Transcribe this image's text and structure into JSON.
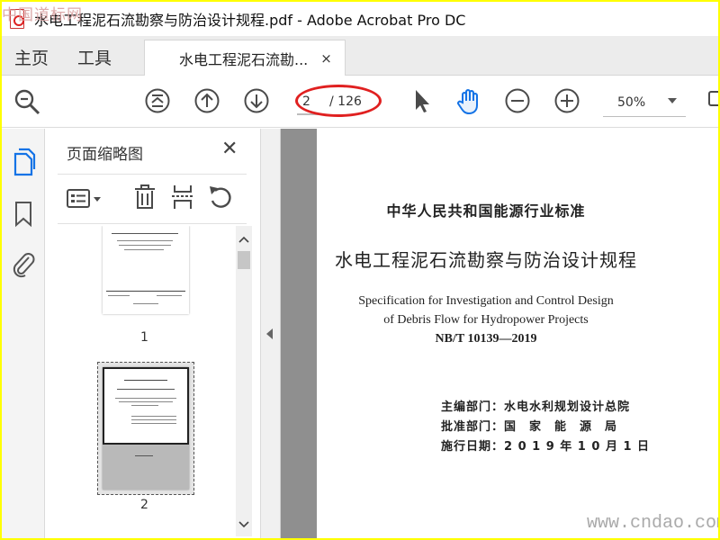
{
  "window": {
    "title": "水电工程泥石流勘察与防治设计规程.pdf - Adobe Acrobat Pro DC",
    "watermark_top": "中国道标网"
  },
  "tabs": {
    "home": "主页",
    "tools": "工具",
    "document": "水电工程泥石流勘...",
    "close": "×"
  },
  "toolbar": {
    "current_page": "2",
    "total_pages": "/ 126",
    "zoom": "50%"
  },
  "panel": {
    "title": "页面缩略图",
    "close": "✕",
    "thumbnails": [
      {
        "label": "1"
      },
      {
        "label": "2"
      }
    ]
  },
  "document": {
    "line1": "中华人民共和国能源行业标准",
    "line2": "水电工程泥石流勘察与防治设计规程",
    "en1": "Specification for Investigation and Control Design",
    "en2": "of Debris Flow for Hydropower Projects",
    "code": "NB/T 10139—2019",
    "editor": "主编部门：水电水利规划设计总院",
    "approver": "批准部门：国　家　能　源　局",
    "effective": "施行日期：2 0 1 9 年 1 0 月 1 日"
  },
  "watermark_bottom": "www.cndao.com",
  "colors": {
    "frame": "#ffff00",
    "accent": "#1473e6",
    "highlight_ellipse": "#e02020"
  }
}
